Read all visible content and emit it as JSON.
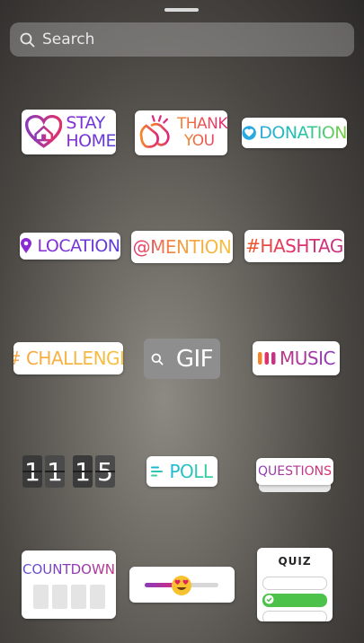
{
  "search": {
    "placeholder": "Search"
  },
  "stickers": {
    "stay_home": [
      "STAY",
      "HOME"
    ],
    "thank_you": [
      "THANK",
      "YOU"
    ],
    "donation": "DONATION",
    "location": "LOCATION",
    "mention": "@MENTION",
    "hashtag": "#HASHTAG",
    "challenge": "# CHALLENGE",
    "gif": "GIF",
    "music": "MUSIC",
    "countdown_digits": [
      "1",
      "1",
      "1",
      "5"
    ],
    "poll": "POLL",
    "questions": "QUESTIONS",
    "countdown": "COUNTDOWN",
    "slider_emoji": "😍",
    "quiz": "QUIZ"
  },
  "colors": {
    "instagram_pink": "#dd2a7b",
    "instagram_purple": "#8a3ab9",
    "quiz_green": "#4cc24a"
  }
}
